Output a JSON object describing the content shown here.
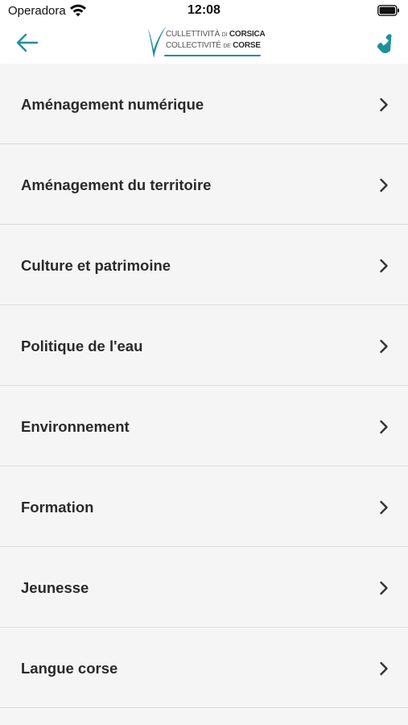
{
  "status_bar": {
    "carrier": "Operadora",
    "time": "12:08",
    "wifi_icon": "wifi-icon",
    "battery_icon": "battery-icon"
  },
  "nav_bar": {
    "back_icon": "arrow-left-icon",
    "phone_icon": "phone-icon",
    "logo": {
      "line1_part1": "CULLETTIVITÀ",
      "line1_part2": "DI",
      "line1_part3": "CORSICA",
      "line2_part1": "COLLECTIVITÉ",
      "line2_part2": "DE",
      "line2_part3": "CORSE"
    }
  },
  "colors": {
    "accent": "#1f8f9a",
    "background": "#f5f5f5",
    "divider": "#dcdcdc",
    "text": "#2a2a2a"
  },
  "menu": {
    "items": [
      {
        "label": "Aménagement numérique"
      },
      {
        "label": "Aménagement du territoire"
      },
      {
        "label": "Culture et patrimoine"
      },
      {
        "label": "Politique de l'eau"
      },
      {
        "label": "Environnement"
      },
      {
        "label": "Formation"
      },
      {
        "label": "Jeunesse"
      },
      {
        "label": "Langue corse"
      }
    ]
  }
}
